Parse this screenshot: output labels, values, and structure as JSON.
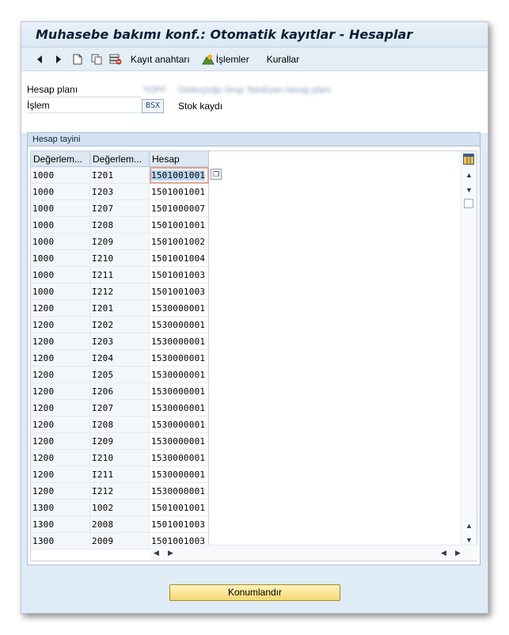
{
  "window": {
    "title": "Muhasebe bakımı konf.: Otomatik kayıtlar - Hesaplar"
  },
  "toolbar": {
    "buttons": [
      {
        "icon": "back-arrow-icon"
      },
      {
        "icon": "forward-arrow-icon"
      },
      {
        "icon": "new-document-icon"
      },
      {
        "icon": "copy-icon"
      },
      {
        "icon": "delete-icon"
      }
    ],
    "posting_key_label": "Kayıt anahtarı",
    "procedures_label": "İşlemler",
    "rules_label": "Kurallar"
  },
  "header": {
    "chart_label": "Hesap planı",
    "chart_value": "TOPF",
    "chart_desc": "Otokoçluğu Grup Tekdüzen hesap planı",
    "transaction_label": "İşlem",
    "transaction_value": "BSX",
    "transaction_desc": "Stok kaydı"
  },
  "group": {
    "title": "Hesap tayini"
  },
  "table": {
    "columns": [
      "Değerlem...",
      "Değerlem...",
      "Hesap"
    ],
    "rows": [
      [
        "1000",
        "I201",
        "1501001001"
      ],
      [
        "1000",
        "I203",
        "1501001001"
      ],
      [
        "1000",
        "I207",
        "1501000007"
      ],
      [
        "1000",
        "I208",
        "1501001001"
      ],
      [
        "1000",
        "I209",
        "1501001002"
      ],
      [
        "1000",
        "I210",
        "1501001004"
      ],
      [
        "1000",
        "I211",
        "1501001003"
      ],
      [
        "1000",
        "I212",
        "1501001003"
      ],
      [
        "1200",
        "I201",
        "1530000001"
      ],
      [
        "1200",
        "I202",
        "1530000001"
      ],
      [
        "1200",
        "I203",
        "1530000001"
      ],
      [
        "1200",
        "I204",
        "1530000001"
      ],
      [
        "1200",
        "I205",
        "1530000001"
      ],
      [
        "1200",
        "I206",
        "1530000001"
      ],
      [
        "1200",
        "I207",
        "1530000001"
      ],
      [
        "1200",
        "I208",
        "1530000001"
      ],
      [
        "1200",
        "I209",
        "1530000001"
      ],
      [
        "1200",
        "I210",
        "1530000001"
      ],
      [
        "1200",
        "I211",
        "1530000001"
      ],
      [
        "1200",
        "I212",
        "1530000001"
      ],
      [
        "1300",
        "1002",
        "1501001001"
      ],
      [
        "1300",
        "2008",
        "1501001003"
      ],
      [
        "1300",
        "2009",
        "1501001003"
      ]
    ]
  },
  "footer": {
    "position_button_label": "Konumlandır"
  }
}
